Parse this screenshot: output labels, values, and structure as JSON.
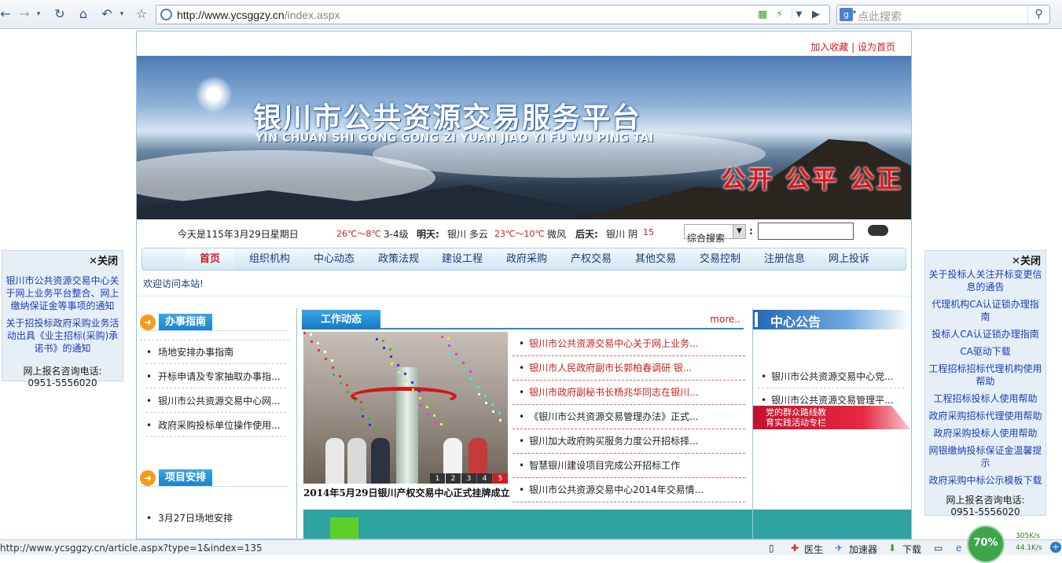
{
  "browser": {
    "url_host": "http://www.ycsggzy.cn",
    "url_path": "/index.aspx",
    "search_placeholder": "点此搜索",
    "search_engine_badge": "g"
  },
  "status_bar": {
    "link_url": "http://www.ycsggzy.cn/article.aspx?type=1&index=135",
    "items": [
      "医生",
      "加速器",
      "下载"
    ],
    "speed_up": "305K/s",
    "speed_down": "44.1K/s",
    "progress": "70%"
  },
  "top_links": {
    "favorite": "加入收藏",
    "sep": " | ",
    "homepage": "设为首页"
  },
  "banner": {
    "title": "银川市公共资源交易服务平台",
    "pinyin": "YIN CHUAN SHI GONG GONG ZI YUAN JIAO YI FU WU PING TAI",
    "motto": "公开 公平 公正"
  },
  "info_bar": {
    "date": "今天是115年3月29日星期日",
    "today_temp": "26℃～8℃",
    "today_wind": "3-4级",
    "tomorrow_label": "明天:",
    "tomorrow_weather": "银川 多云",
    "tomorrow_temp": "23℃～10℃",
    "tomorrow_wind": "微风",
    "after_label": "后天:",
    "after_weather": "银川 阴",
    "after_temp": "15",
    "search_scope": "综合搜索",
    "colon": ":"
  },
  "nav": [
    "首页",
    "组织机构",
    "中心动态",
    "政策法规",
    "建设工程",
    "政府采购",
    "产权交易",
    "其他交易",
    "交易控制",
    "注册信息",
    "网上投诉"
  ],
  "welcome": "欢迎访问本站!",
  "guide": {
    "title": "办事指南",
    "items": [
      "场地安排办事指南",
      "开标申请及专家抽取办事指...",
      "银川市公共资源交易中心网...",
      "政府采购投标单位操作使用..."
    ]
  },
  "schedule": {
    "title": "项目安排",
    "items": [
      "3月27日场地安排"
    ]
  },
  "news": {
    "title": "工作动态",
    "more": "more..",
    "caption": "2014年5月29日银川产权交易中心正式挂牌成立",
    "pages": [
      "1",
      "2",
      "3",
      "4",
      "5"
    ],
    "items": [
      {
        "text": "银川市公共资源交易中心关于网上业务...",
        "red": true
      },
      {
        "text": "银川市人民政府副市长郭柏春调研 银...",
        "red": true
      },
      {
        "text": "银川市政府副秘书长杨兆华同志在银川...",
        "red": true
      },
      {
        "text": "《银川市公共资源交易管理办法》正式...",
        "red": false
      },
      {
        "text": "银川加大政府购买服务力度公开招标择...",
        "red": false
      },
      {
        "text": "智慧银川建设项目完成公开招标工作",
        "red": false
      },
      {
        "text": "银川市公共资源交易中心2014年交易情...",
        "red": false
      }
    ]
  },
  "notice": {
    "title": "中心公告",
    "items": [
      "银川市公共资源交易中心党...",
      "银川市公共资源交易管理平..."
    ],
    "promo_line1": "党的群众路线教",
    "promo_line2": "育实践活动专栏"
  },
  "left_panel": {
    "close": "✕关闭",
    "links": [
      "银川市公共资源交易中心关于网上业务平台整合、网上缴纳保证金等事项的通知",
      "关于招投标政府采购业务活动出具《业主招标(采购)承诺书》的通知"
    ],
    "phone_label": "网上报名咨询电话:",
    "phone": "0951-5556020"
  },
  "right_panel": {
    "close": "✕关闭",
    "links": [
      "关于投标人关注开标变更信息的通告",
      "代理机构CA认证锁办理指南",
      "投标人CA认证锁办理指南",
      "CA驱动下载",
      "工程招标招标代理机构使用帮助",
      "工程招标投标人使用帮助",
      "政府采购招标代理使用帮助",
      "政府采购投标人使用帮助",
      "网银缴纳投标保证金温馨提示",
      "政府采购中标公示模板下载"
    ],
    "phone_label": "网上报名咨询电话:",
    "phone": "0951-5556020"
  },
  "colors": {
    "accent_red": "#c8201f",
    "link_blue": "#1d3fb8",
    "nav_blue": "#1b3b78",
    "teal": "#2ea3a0"
  }
}
